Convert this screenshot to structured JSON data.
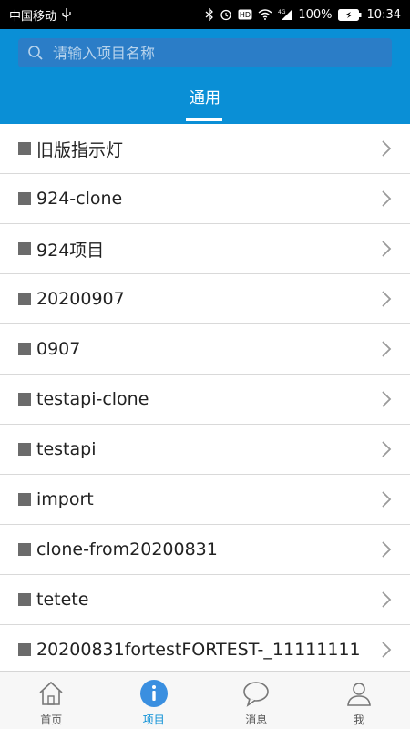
{
  "status_bar": {
    "carrier": "中国移动",
    "battery": "100%",
    "time": "10:34",
    "icons": [
      "usb-icon",
      "bluetooth-icon",
      "alarm-icon",
      "hd-icon",
      "wifi-icon",
      "signal-4g-icon",
      "battery-icon"
    ]
  },
  "search": {
    "placeholder": "请输入项目名称"
  },
  "tabs": {
    "general": "通用"
  },
  "list": {
    "items": [
      {
        "label": "旧版指示灯"
      },
      {
        "label": "924-clone"
      },
      {
        "label": "924项目"
      },
      {
        "label": "20200907"
      },
      {
        "label": "0907"
      },
      {
        "label": "testapi-clone"
      },
      {
        "label": "testapi"
      },
      {
        "label": "import"
      },
      {
        "label": "clone-from20200831"
      },
      {
        "label": "tetete"
      },
      {
        "label": "20200831fortestFORTEST-_11111111"
      }
    ]
  },
  "bottom_nav": {
    "home": "首页",
    "projects": "项目",
    "messages": "消息",
    "me": "我"
  },
  "colors": {
    "primary": "#0a8fd6",
    "search_bg": "#2b7dc7",
    "bullet": "#6b6b6b"
  }
}
